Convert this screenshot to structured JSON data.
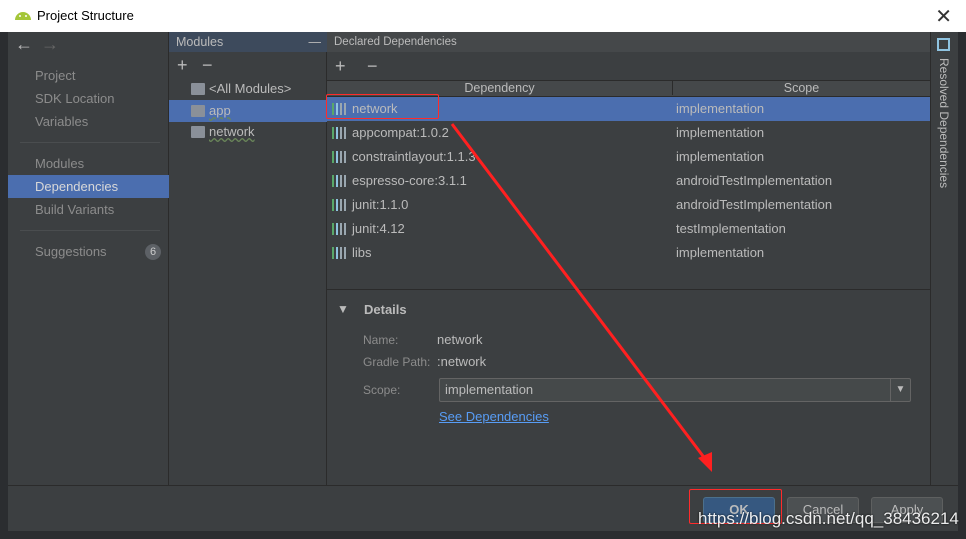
{
  "window": {
    "title": "Project Structure",
    "close": "✕"
  },
  "sidebar": {
    "back": "←",
    "forward": "→",
    "items": [
      {
        "label": "Project"
      },
      {
        "label": "SDK Location"
      },
      {
        "label": "Variables"
      },
      {
        "label": "Modules"
      },
      {
        "label": "Dependencies",
        "selected": true
      },
      {
        "label": "Build Variants"
      },
      {
        "label": "Suggestions",
        "badge": "6"
      }
    ]
  },
  "modules": {
    "header": "Modules",
    "collapse": "—",
    "add": "+",
    "remove": "−",
    "items": [
      {
        "label": "<All Modules>"
      },
      {
        "label": "app",
        "selected": true
      },
      {
        "label": "network"
      }
    ]
  },
  "deps": {
    "header": "Declared Dependencies",
    "add": "+",
    "remove": "−",
    "columns": [
      "Dependency",
      "Scope"
    ],
    "rows": [
      {
        "name": "network",
        "scope": "implementation",
        "selected": true
      },
      {
        "name": "appcompat:1.0.2",
        "scope": "implementation"
      },
      {
        "name": "constraintlayout:1.1.3",
        "scope": "implementation"
      },
      {
        "name": "espresso-core:3.1.1",
        "scope": "androidTestImplementation"
      },
      {
        "name": "junit:1.1.0",
        "scope": "androidTestImplementation"
      },
      {
        "name": "junit:4.12",
        "scope": "testImplementation"
      },
      {
        "name": "libs",
        "scope": "implementation"
      }
    ]
  },
  "details": {
    "title": "Details",
    "toggle": "▼",
    "name_label": "Name:",
    "name": "network",
    "path_label": "Gradle Path:",
    "path": ":network",
    "scope_label": "Scope:",
    "scope": "implementation",
    "link": "See Dependencies"
  },
  "right_panel": {
    "label": "Resolved Dependencies"
  },
  "buttons": {
    "ok": "OK",
    "cancel": "Cancel",
    "apply": "Apply"
  },
  "watermark": "https://blog.csdn.net/qq_38436214",
  "colors": {
    "selection": "#4b6eaf",
    "annotation": "#ff2b2b",
    "link": "#589df6"
  }
}
